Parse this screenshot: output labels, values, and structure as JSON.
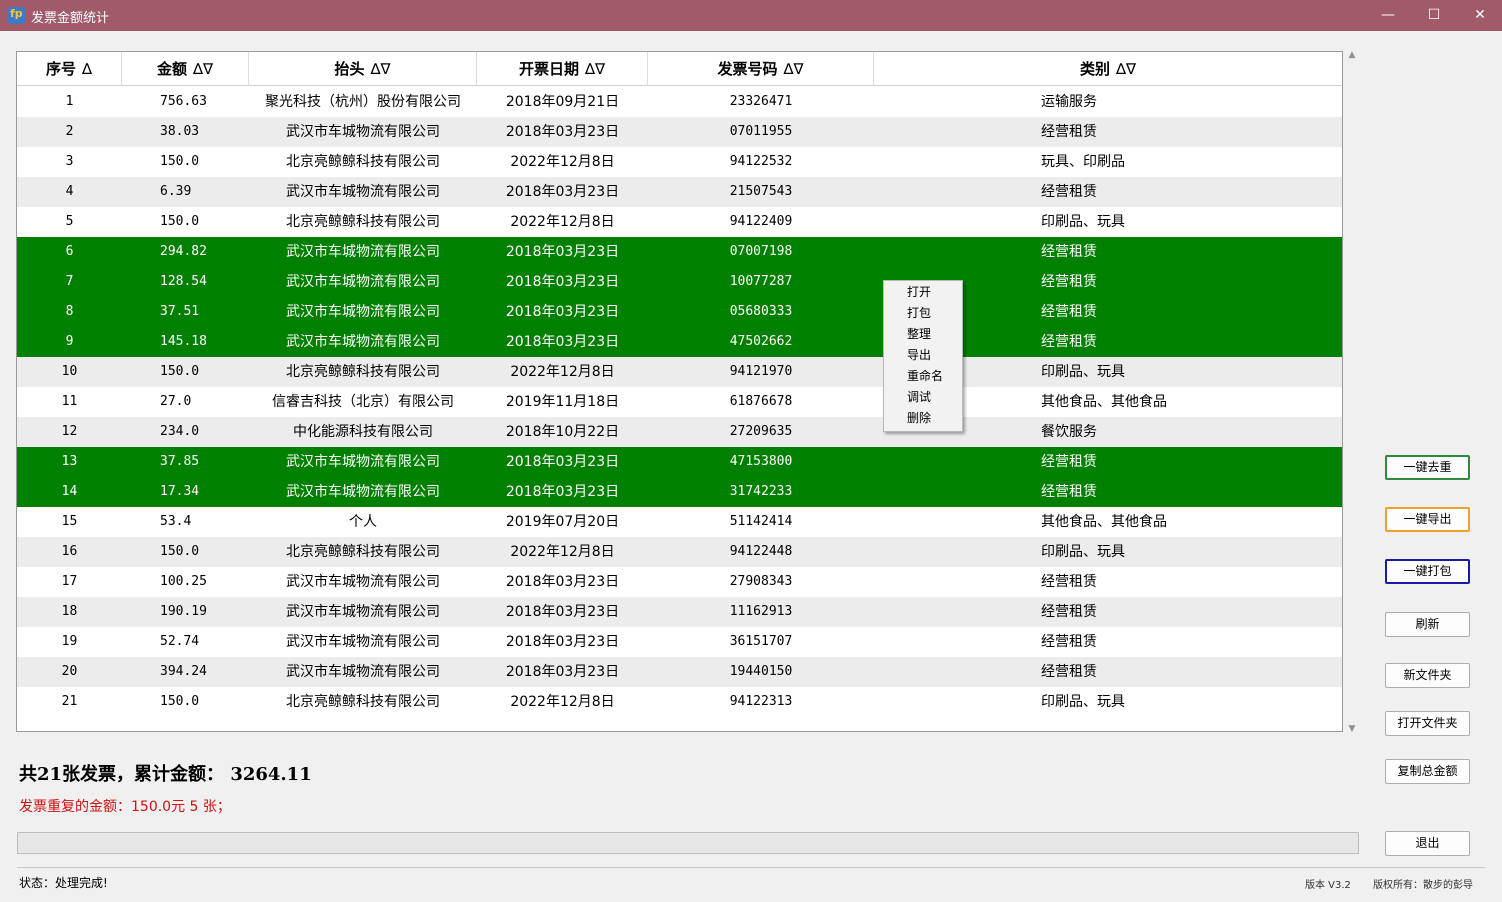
{
  "window": {
    "title": "发票金额统计",
    "icon_text": "fp",
    "minimize_glyph": "—",
    "maximize_glyph": "☐",
    "close_glyph": "✕"
  },
  "table": {
    "columns": [
      {
        "label": "序号",
        "sort": "∆"
      },
      {
        "label": "金额",
        "sort": "∆∇"
      },
      {
        "label": "抬头",
        "sort": "∆∇"
      },
      {
        "label": "开票日期",
        "sort": "∆∇"
      },
      {
        "label": "发票号码",
        "sort": "∆∇"
      },
      {
        "label": "类别",
        "sort": "∆∇"
      }
    ],
    "rows": [
      {
        "id": "1",
        "amount": "756.63",
        "payer": "聚光科技（杭州）股份有限公司",
        "date": "2018年09月21日",
        "number": "23326471",
        "category": "运输服务",
        "selected": false
      },
      {
        "id": "2",
        "amount": "38.03",
        "payer": "武汉市车城物流有限公司",
        "date": "2018年03月23日",
        "number": "07011955",
        "category": "经营租赁",
        "selected": false
      },
      {
        "id": "3",
        "amount": "150.0",
        "payer": "北京亮鲸鲸科技有限公司",
        "date": "2022年12月8日",
        "number": "94122532",
        "category": "玩具、印刷品",
        "selected": false
      },
      {
        "id": "4",
        "amount": "6.39",
        "payer": "武汉市车城物流有限公司",
        "date": "2018年03月23日",
        "number": "21507543",
        "category": "经营租赁",
        "selected": false
      },
      {
        "id": "5",
        "amount": "150.0",
        "payer": "北京亮鲸鲸科技有限公司",
        "date": "2022年12月8日",
        "number": "94122409",
        "category": "印刷品、玩具",
        "selected": false
      },
      {
        "id": "6",
        "amount": "294.82",
        "payer": "武汉市车城物流有限公司",
        "date": "2018年03月23日",
        "number": "07007198",
        "category": "经营租赁",
        "selected": true
      },
      {
        "id": "7",
        "amount": "128.54",
        "payer": "武汉市车城物流有限公司",
        "date": "2018年03月23日",
        "number": "10077287",
        "category": "经营租赁",
        "selected": true
      },
      {
        "id": "8",
        "amount": "37.51",
        "payer": "武汉市车城物流有限公司",
        "date": "2018年03月23日",
        "number": "05680333",
        "category": "经营租赁",
        "selected": true
      },
      {
        "id": "9",
        "amount": "145.18",
        "payer": "武汉市车城物流有限公司",
        "date": "2018年03月23日",
        "number": "47502662",
        "category": "经营租赁",
        "selected": true
      },
      {
        "id": "10",
        "amount": "150.0",
        "payer": "北京亮鲸鲸科技有限公司",
        "date": "2022年12月8日",
        "number": "94121970",
        "category": "印刷品、玩具",
        "selected": false
      },
      {
        "id": "11",
        "amount": "27.0",
        "payer": "信睿吉科技（北京）有限公司",
        "date": "2019年11月18日",
        "number": "61876678",
        "category": "其他食品、其他食品",
        "selected": false
      },
      {
        "id": "12",
        "amount": "234.0",
        "payer": "中化能源科技有限公司",
        "date": "2018年10月22日",
        "number": "27209635",
        "category": "餐饮服务",
        "selected": false
      },
      {
        "id": "13",
        "amount": "37.85",
        "payer": "武汉市车城物流有限公司",
        "date": "2018年03月23日",
        "number": "47153800",
        "category": "经营租赁",
        "selected": true
      },
      {
        "id": "14",
        "amount": "17.34",
        "payer": "武汉市车城物流有限公司",
        "date": "2018年03月23日",
        "number": "31742233",
        "category": "经营租赁",
        "selected": true
      },
      {
        "id": "15",
        "amount": "53.4",
        "payer": "个人",
        "date": "2019年07月20日",
        "number": "51142414",
        "category": "其他食品、其他食品",
        "selected": false
      },
      {
        "id": "16",
        "amount": "150.0",
        "payer": "北京亮鲸鲸科技有限公司",
        "date": "2022年12月8日",
        "number": "94122448",
        "category": "印刷品、玩具",
        "selected": false
      },
      {
        "id": "17",
        "amount": "100.25",
        "payer": "武汉市车城物流有限公司",
        "date": "2018年03月23日",
        "number": "27908343",
        "category": "经营租赁",
        "selected": false
      },
      {
        "id": "18",
        "amount": "190.19",
        "payer": "武汉市车城物流有限公司",
        "date": "2018年03月23日",
        "number": "11162913",
        "category": "经营租赁",
        "selected": false
      },
      {
        "id": "19",
        "amount": "52.74",
        "payer": "武汉市车城物流有限公司",
        "date": "2018年03月23日",
        "number": "36151707",
        "category": "经营租赁",
        "selected": false
      },
      {
        "id": "20",
        "amount": "394.24",
        "payer": "武汉市车城物流有限公司",
        "date": "2018年03月23日",
        "number": "19440150",
        "category": "经营租赁",
        "selected": false
      },
      {
        "id": "21",
        "amount": "150.0",
        "payer": "北京亮鲸鲸科技有限公司",
        "date": "2022年12月8日",
        "number": "94122313",
        "category": "印刷品、玩具",
        "selected": false
      }
    ]
  },
  "context_menu": {
    "items": [
      "打开",
      "打包",
      "整理",
      "导出",
      "重命名",
      "调试",
      "删除"
    ]
  },
  "side_buttons": [
    {
      "label": "一键去重",
      "name": "dedupe-button"
    },
    {
      "label": "一键导出",
      "name": "export-all-button"
    },
    {
      "label": "一键打包",
      "name": "pack-all-button"
    },
    {
      "label": "刷新",
      "name": "refresh-button"
    },
    {
      "label": "新文件夹",
      "name": "new-folder-button"
    },
    {
      "label": "打开文件夹",
      "name": "open-folder-button"
    },
    {
      "label": "复制总金额",
      "name": "copy-total-button"
    },
    {
      "label": "退出",
      "name": "exit-button"
    }
  ],
  "summary": {
    "text": "共21张发票，累计金额： 3264.11",
    "duplicate_text": "发票重复的金额：150.0元 5 张；"
  },
  "progress": {
    "value": 0
  },
  "status_bar": {
    "status": "状态：处理完成!",
    "version": "版本 V3.2",
    "copyright": "版权所有：散步的彭导"
  },
  "colors": {
    "titlebar": "#a05a6a",
    "selected_row": "#008000",
    "alt_row": "#ececec",
    "duplicate_text": "#d01010",
    "dedupe_border": "#2e8b3e",
    "export_border": "#f0a030",
    "pack_border": "#1a1aa8"
  }
}
